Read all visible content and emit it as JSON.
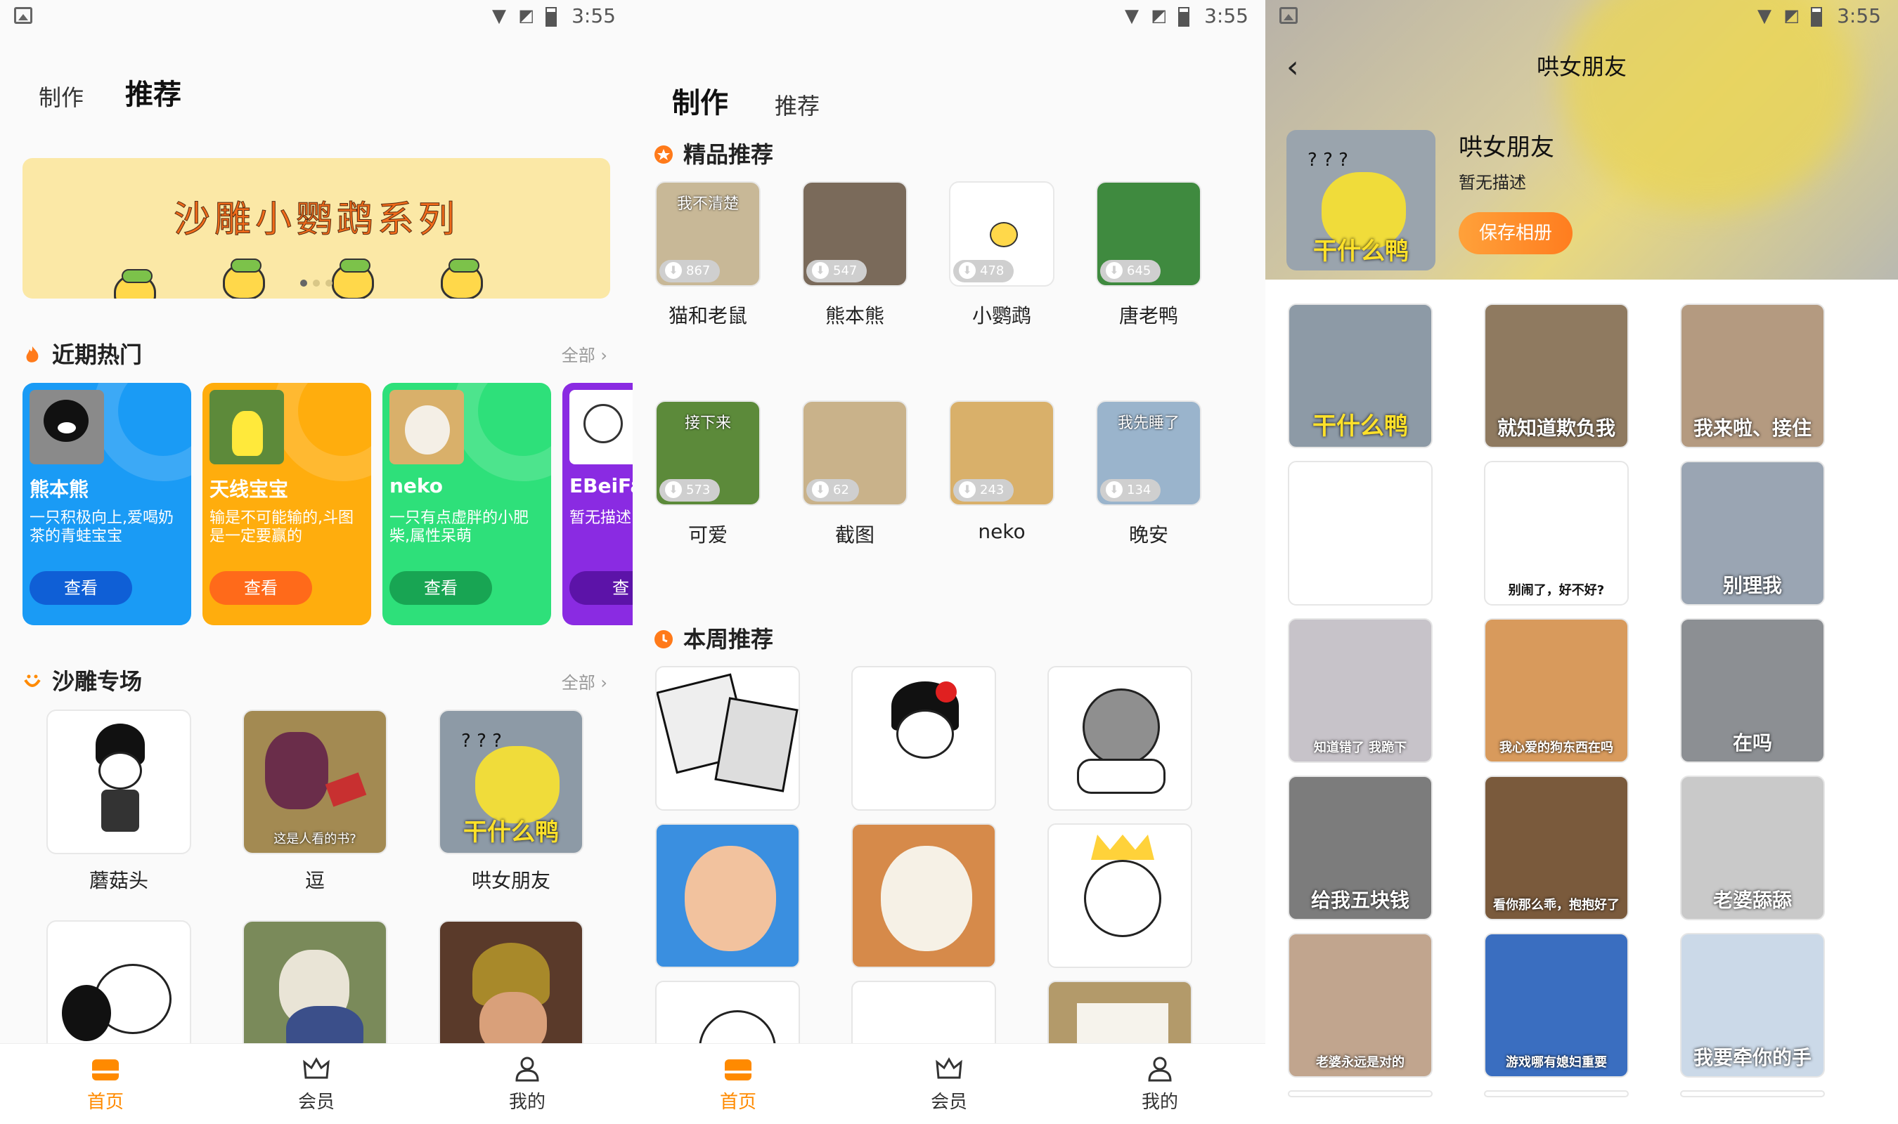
{
  "status": {
    "time": "3:55"
  },
  "screen1": {
    "tabs": [
      "制作",
      "推荐"
    ],
    "banner_title": "沙雕小鹦鹉系列",
    "hot": {
      "title": "近期热门",
      "all": "全部",
      "cards": [
        {
          "name": "熊本熊",
          "desc": "一只积极向上,爱喝奶茶的青蛙宝宝",
          "view": "查看",
          "bg": "#1a9bf5",
          "btn": "#0f5fd6"
        },
        {
          "name": "天线宝宝",
          "desc": "输是不可能输的,斗图是一定要赢的",
          "view": "查看",
          "bg": "#ffad0d",
          "btn": "#ff6a1a"
        },
        {
          "name": "neko",
          "desc": "一只有点虚胖的小肥柴,属性呆萌",
          "view": "查看",
          "bg": "#2ee07a",
          "btn": "#18a553"
        },
        {
          "name": "EBeiFa",
          "desc": "暂无描述",
          "view": "查",
          "bg": "#8a2be2",
          "btn": "#5c13a8"
        }
      ]
    },
    "special": {
      "title": "沙雕专场",
      "all": "全部",
      "items": [
        {
          "label": "蘑菇头",
          "caption": ""
        },
        {
          "label": "逗",
          "caption": "这是人看的书?"
        },
        {
          "label": "哄女朋友",
          "caption": "干什么鸭"
        },
        {
          "label": "",
          "caption": ""
        },
        {
          "label": "",
          "caption": ""
        },
        {
          "label": "",
          "caption": ""
        }
      ]
    }
  },
  "screen2": {
    "tabs": [
      "制作",
      "推荐"
    ],
    "featured": {
      "title": "精品推荐",
      "items": [
        {
          "label": "猫和老鼠",
          "count": "867",
          "caption": "我不清楚"
        },
        {
          "label": "熊本熊",
          "count": "547",
          "caption": ""
        },
        {
          "label": "小鹦鹉",
          "count": "478",
          "caption": ""
        },
        {
          "label": "唐老鸭",
          "count": "645",
          "caption": ""
        },
        {
          "label": "可爱",
          "count": "573",
          "caption": "接下来"
        },
        {
          "label": "截图",
          "count": "62",
          "caption": ""
        },
        {
          "label": "neko",
          "count": "243",
          "caption": ""
        },
        {
          "label": "晚安",
          "count": "134",
          "caption": "我先睡了"
        }
      ]
    },
    "weekly": {
      "title": "本周推荐"
    }
  },
  "screen3": {
    "title": "哄女朋友",
    "album_name": "哄女朋友",
    "album_desc": "暂无描述",
    "save": "保存相册",
    "cover_caption": "干什么鸭",
    "photos": [
      {
        "caption": "干什么鸭",
        "bg": "#8d9aa6"
      },
      {
        "caption": "就知道欺负我",
        "bg": "#8f7a60"
      },
      {
        "caption": "我来啦、接住",
        "bg": "#b49a80"
      },
      {
        "caption": "",
        "bg": "#ffffff"
      },
      {
        "caption": "别闹了，好不好?",
        "bg": "#ffffff"
      },
      {
        "caption": "别理我",
        "bg": "#9aa5b3"
      },
      {
        "caption": "知道错了 我跪下",
        "bg": "#c7c3c9"
      },
      {
        "caption": "我心爱的狗东西在吗",
        "bg": "#d89a5c"
      },
      {
        "caption": "在吗",
        "bg": "#8c8f93"
      },
      {
        "caption": "给我五块钱",
        "bg": "#7c7c7c"
      },
      {
        "caption": "看你那么乖，抱抱好了",
        "bg": "#7a5a3c"
      },
      {
        "caption": "老婆舔舔",
        "bg": "#c9c9c9"
      },
      {
        "caption": "老婆永远是对的",
        "bg": "#c1a58e"
      },
      {
        "caption": "游戏哪有媳妇重要",
        "bg": "#3a6ec0"
      },
      {
        "caption": "我要牵你的手",
        "bg": "#cbd9e8"
      }
    ]
  },
  "nav": {
    "home": "首页",
    "vip": "会员",
    "mine": "我的"
  },
  "colors": {
    "accent": "#ff8a00"
  }
}
